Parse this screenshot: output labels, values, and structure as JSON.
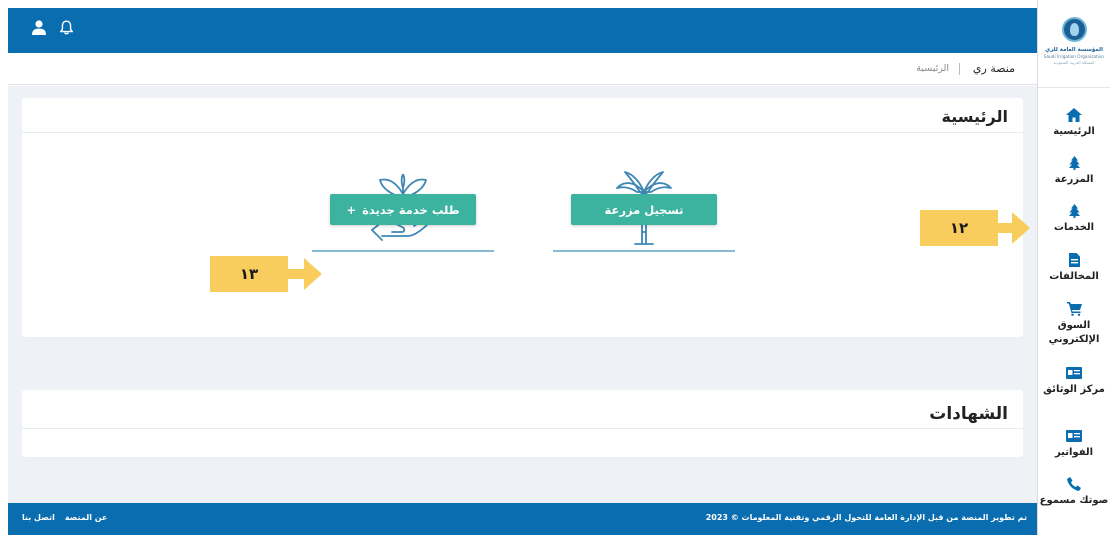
{
  "brand": {
    "line1": "المؤسسة العامة للري",
    "line2": "Saudi Irrigation Organization",
    "line3": "المملكة العربية السعودية",
    "primary_color": "#0a6daf",
    "accent_color": "#3bb39f"
  },
  "sidebar": {
    "items": [
      {
        "label": "الرئيسية",
        "icon": "home-icon"
      },
      {
        "label": "المزرعة",
        "icon": "tree-icon"
      },
      {
        "label": "الخدمات",
        "icon": "tree-icon"
      },
      {
        "label": "المخالفات",
        "icon": "document-icon"
      },
      {
        "label": "السوق الإلكتروني",
        "icon": "cart-icon"
      },
      {
        "label": "مركز الوثائق",
        "icon": "id-card-icon"
      },
      {
        "label": "الفواتير",
        "icon": "id-card-icon"
      },
      {
        "label": "صوتك مسموع",
        "icon": "phone-icon"
      }
    ]
  },
  "topbar": {
    "icons": [
      "user-icon",
      "bell-icon"
    ]
  },
  "breadcrumb": {
    "platform": "منصة ري",
    "current": "الرئيسية"
  },
  "home_card": {
    "title": "الرئيسية",
    "actions": [
      {
        "label": "تسجيل مزرعة",
        "icon": "palm-tree-icon"
      },
      {
        "label": "طلب خدمة جديدة",
        "prefix": "+",
        "icon": "hand-plant-icon"
      }
    ]
  },
  "certificates": {
    "title": "الشهادات"
  },
  "annotations": [
    {
      "label": "١٢",
      "points_to": "الخدمات"
    },
    {
      "label": "١٣",
      "points_to": "طلب خدمة جديدة"
    }
  ],
  "footer": {
    "copyright": "تم تطوير المنصة من قبل الإدارة العامة للتحول الرقمي وتقنية المعلومات © 2023",
    "links": [
      "عن المنصة",
      "اتصل بنا"
    ]
  }
}
